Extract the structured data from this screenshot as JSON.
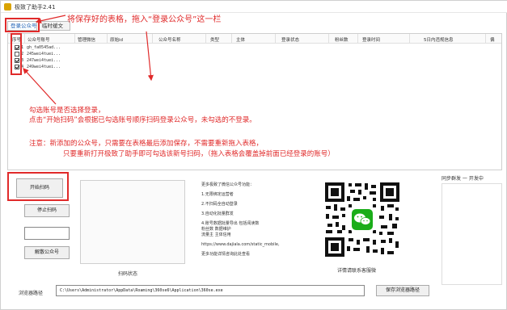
{
  "window": {
    "title": "极致了助手2.41"
  },
  "tabs": [
    {
      "label": "登录公众号",
      "active": true
    },
    {
      "label": "临时缓文",
      "active": false
    }
  ],
  "table": {
    "columns": [
      "序号",
      "公众号账号",
      "管理微信",
      "原始id",
      "公众号名称",
      "类型",
      "主体",
      "登录状态",
      "粉丝数",
      "登录时间",
      "5日内违规信息",
      "偏"
    ],
    "rows": [
      {
        "checked": true,
        "num": "1",
        "account": "gh_fa0545ad..."
      },
      {
        "checked": false,
        "num": "2",
        "account": "245wei4tuei..."
      },
      {
        "checked": true,
        "num": "3",
        "account": "247wei4tuei..."
      },
      {
        "checked": true,
        "num": "4",
        "account": "249wei4tuei..."
      }
    ]
  },
  "annotations": {
    "top": "将保存好的表格，拖入“登录公众号”这一栏",
    "line1": "勾选账号是否选择登录，",
    "line2": "点击“开始扫码”会根据已勾选账号顺序扫码登录公众号，未勾选的不登录。",
    "line3": "注意：新添加的公众号，只需要在表格最后添加保存，不需要重新拖入表格，",
    "line4": "只要重新打开极致了助手即可勾选该新号扫码，（拖入表格会覆盖掉前面已经登录的账号）"
  },
  "controls": {
    "start_scan": "开始扫码",
    "stop_scan": "停止扫码",
    "delete_account": "解散公众号",
    "scan_status": "扫码状态",
    "sync_label": "同步群发 一 开发中",
    "qr_caption": "详情请联系客服微",
    "browser_path_label": "浏览器路径",
    "browser_path_value": "C:\\Users\\Administrator\\AppData\\Roaming\\360se6\\Application\\360se.exe",
    "save_browser_path": "保存浏览器路径"
  },
  "info": {
    "heading": "更多极致了微信公众号功能：",
    "items": [
      "1.无限绑定运营者",
      "2.不扫码全自动登录",
      "3.自动化批量群发",
      "4.账号数据批量导出 包括阅读数",
      "粉丝数 数据维护",
      "流量主 主体信用"
    ],
    "url": "https://www.dajiala.com/static_mobile,",
    "footer": "更多功能详情咨询此处查看"
  },
  "colors": {
    "annotation": "#e02a2a",
    "wechat_green": "#1aad19"
  }
}
